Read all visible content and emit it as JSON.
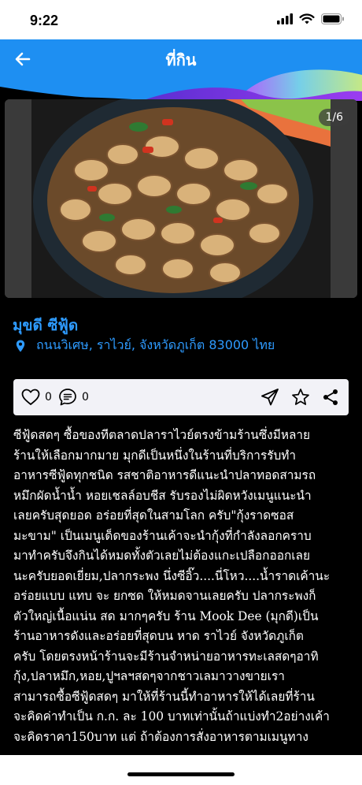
{
  "status_bar": {
    "time": "9:22"
  },
  "header": {
    "title": "ที่กิน"
  },
  "gallery": {
    "counter": "1/6"
  },
  "place": {
    "name": "มุขดี ซีฟู้ด",
    "address": "ถนนวิเศษ, ราไวย์, จังหวัดภูเก็ต 83000 ไทย"
  },
  "actions": {
    "likes": "0",
    "comments": "0"
  },
  "description": [
    "ซีฟู้ดสดๆ ซื้อของทีตลาดปลาราไวย์ตรงข้ามร้านซึ่งมีหลาย",
    "ร้านให้เลือกมากมาย มุกดีเป็นหนึ่งในร้านที่บริการรับทำ",
    "อาหารซีฟู้ดทุกชนิด รสชาติอาหารดีแนะนำปลาทอดสามรถ",
    "หมึกผัดน้ำน้ำ หอยเชลล์อบชีส รับรองไม่ผิดหวังเมนูแนะนำ",
    "เลยครับสุดยอด อร่อยที่สุดในสามโลก ครับ\"กุ้งราดซอส",
    "มะขาม\" เป็นเมนูเด็ดของร้านเค้าจะนำกุ้งที่กำลังลอกคราบ",
    "มาทำครับจึงกินได้หมดทั้งตัวเลยไม่ต้องแกะเปลือกออกเลย",
    "นะครับยอดเยี่ยม,ปลากระพง นึ่งซีอิ๊ว....นี่โหว....น้ำราดเค้านะ",
    "อร่อยแบบ แทบ จะ ยกซด ให้หมดจานเลยครับ ปลากระพงก็",
    "ตัวใหญ่เนื้อแน่น สด มากๆครับ ร้าน Mook Dee (มุกดี)เป็น",
    "ร้านอาหารดังและอร่อยที่สุดบน หาด ราไวย์ จังหวัดภูเก็ต",
    "ครับ โดยตรงหน้าร้านจะมีร้านจำหน่ายอาหารทะเลสดๆอาทิ",
    "กุ้ง,ปลาหมึก,หอย,ปูฯลฯสดๆจากชาวเลมาวางขายเรา",
    "สามารถซื้อซีฟู้ดสดๆ มาให้ที่ร้านนี้ทำอาหารให้ได้เลยที่ร้าน",
    "จะคิดค่าทำเป็น ก.ก. ละ 100 บาทเท่านั้นถ้าแบ่งทำ2อย่างเค้า",
    "จะคิดราคา150บาท แต่ ถ้าต้องการสั่งอาหารตามเมนูทาง"
  ]
}
